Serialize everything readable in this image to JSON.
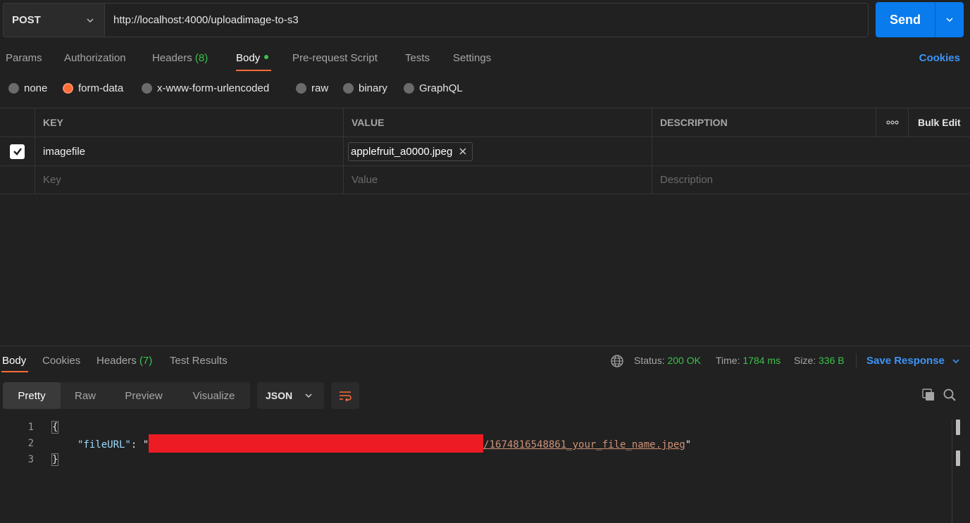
{
  "request": {
    "method": "POST",
    "url": "http://localhost:4000/uploadimage-to-s3",
    "send_label": "Send"
  },
  "request_tabs": {
    "params": "Params",
    "authorization": "Authorization",
    "headers": "Headers",
    "headers_count": "(8)",
    "body": "Body",
    "pre_request": "Pre-request Script",
    "tests": "Tests",
    "settings": "Settings",
    "cookies": "Cookies"
  },
  "body_types": {
    "none": "none",
    "form_data": "form-data",
    "urlencoded": "x-www-form-urlencoded",
    "raw": "raw",
    "binary": "binary",
    "graphql": "GraphQL",
    "selected": "form-data"
  },
  "form_table": {
    "headers": {
      "key": "KEY",
      "value": "VALUE",
      "description": "DESCRIPTION",
      "bulk_edit": "Bulk Edit"
    },
    "rows": [
      {
        "checked": true,
        "key": "imagefile",
        "value_file": "applefruit_a0000.jpeg",
        "description": ""
      }
    ],
    "new_row": {
      "key_placeholder": "Key",
      "value_placeholder": "Value",
      "description_placeholder": "Description"
    }
  },
  "response": {
    "tabs": {
      "body": "Body",
      "cookies": "Cookies",
      "headers": "Headers",
      "headers_count": "(7)",
      "test_results": "Test Results"
    },
    "status_label": "Status:",
    "status_value": "200 OK",
    "time_label": "Time:",
    "time_value": "1784 ms",
    "size_label": "Size:",
    "size_value": "336 B",
    "save_response": "Save Response",
    "views": {
      "pretty": "Pretty",
      "raw": "Raw",
      "preview": "Preview",
      "visualize": "Visualize"
    },
    "format": "JSON",
    "code": {
      "line1_num": "1",
      "line2_num": "2",
      "line3_num": "3",
      "open_brace": "{",
      "close_brace": "}",
      "key": "\"fileURL\"",
      "colon": ": ",
      "quote": "\"",
      "value_visible": "/1674816548861_your_file_name.jpeg",
      "end_quote": "\""
    }
  },
  "colors": {
    "accent_orange": "#ff6c37",
    "send_blue": "#097bed",
    "link_blue": "#3d94f6",
    "success_green": "#3ac24a",
    "redaction_red": "#ed1c24"
  }
}
